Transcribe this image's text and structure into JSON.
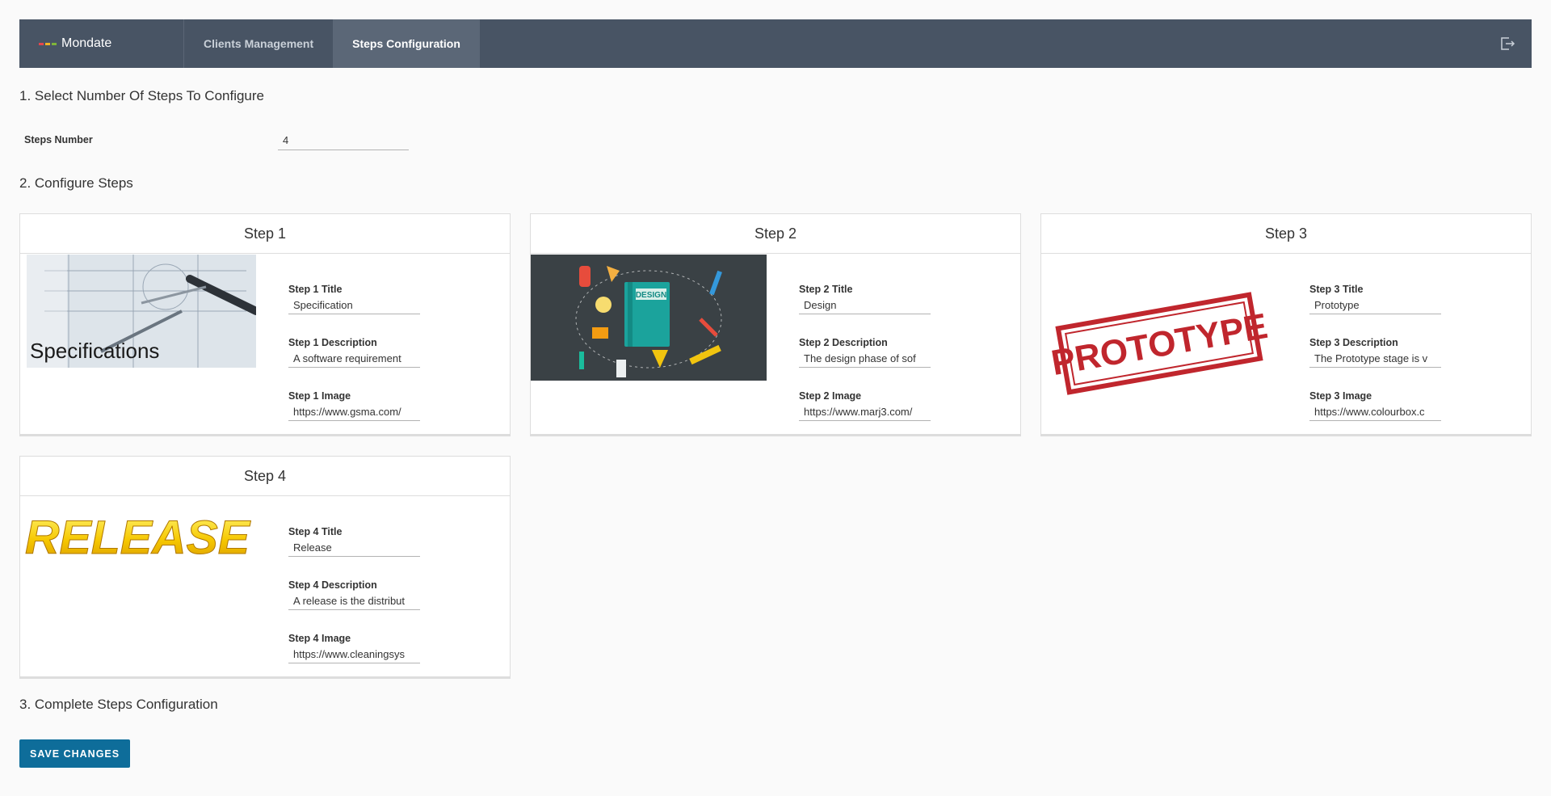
{
  "header": {
    "app_name": "Mondate",
    "brand_colors": [
      "#e4464d",
      "#f0b323",
      "#7fb539"
    ],
    "tabs": [
      {
        "label": "Clients Management",
        "active": false
      },
      {
        "label": "Steps Configuration",
        "active": true
      }
    ],
    "logout_icon": "logout-icon"
  },
  "section1": {
    "title": "1. Select Number Of Steps To Configure",
    "steps_number_label": "Steps Number",
    "steps_number_value": "4"
  },
  "section2": {
    "title": "2. Configure Steps"
  },
  "steps": [
    {
      "header": "Step 1",
      "title_label": "Step 1 Title",
      "title_value": "Specification",
      "description_label": "Step 1 Description",
      "description_value": "A software requirement",
      "image_label": "Step 1 Image",
      "image_value": "https://www.gsma.com/",
      "image_caption": "Specifications"
    },
    {
      "header": "Step 2",
      "title_label": "Step 2 Title",
      "title_value": "Design",
      "description_label": "Step 2 Description",
      "description_value": "The design phase of sof",
      "image_label": "Step 2 Image",
      "image_value": "https://www.marj3.com/",
      "image_caption": "DESIGN"
    },
    {
      "header": "Step 3",
      "title_label": "Step 3 Title",
      "title_value": "Prototype",
      "description_label": "Step 3 Description",
      "description_value": "The Prototype stage is v",
      "image_label": "Step 3 Image",
      "image_value": "https://www.colourbox.c",
      "image_caption": "PROTOTYPE"
    },
    {
      "header": "Step 4",
      "title_label": "Step 4 Title",
      "title_value": "Release",
      "description_label": "Step 4 Description",
      "description_value": "A release is the distribut",
      "image_label": "Step 4 Image",
      "image_value": "https://www.cleaningsys",
      "image_caption": "RELEASE"
    }
  ],
  "section3": {
    "title": "3. Complete Steps Configuration",
    "save_label": "SAVE CHANGES"
  },
  "colors": {
    "header_bg": "#485464",
    "active_tab_bg": "#5b6777",
    "page_bg": "#fafafa",
    "primary_button": "#0e6d9a"
  }
}
